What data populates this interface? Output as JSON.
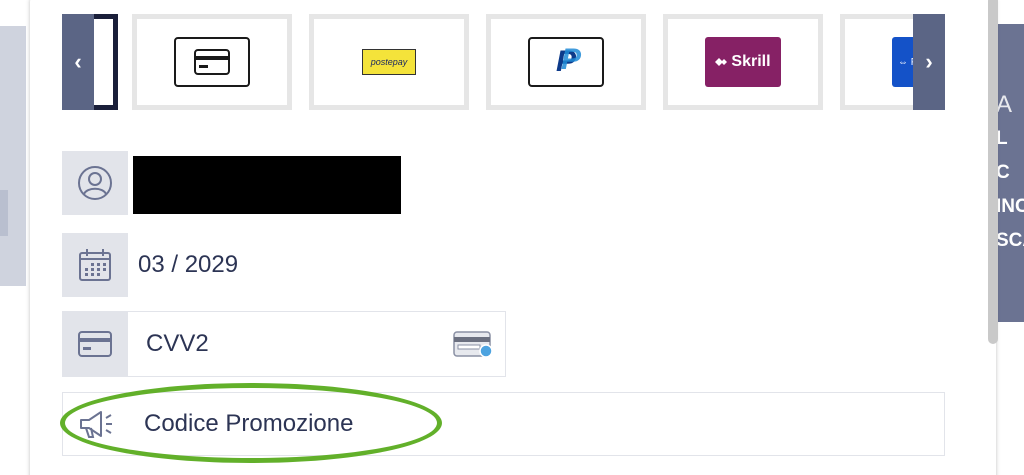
{
  "background": {
    "right_panel_lines": [
      "A",
      "L",
      "C",
      "INC",
      "SCA"
    ]
  },
  "carousel": {
    "prev_arrow": "‹",
    "next_arrow": "›",
    "methods": [
      {
        "name": "card-icon"
      },
      {
        "label": "postepay"
      },
      {
        "label": "P"
      },
      {
        "label": "Skrill"
      },
      {
        "label": "⇔ Pa"
      }
    ]
  },
  "form": {
    "expiry_value": "03 / 2029",
    "cvv_placeholder": "CVV2",
    "promo_placeholder": "Codice Promozione"
  },
  "colors": {
    "accent": "#5b6585",
    "highlight": "#62b02a",
    "text": "#2c3454"
  }
}
